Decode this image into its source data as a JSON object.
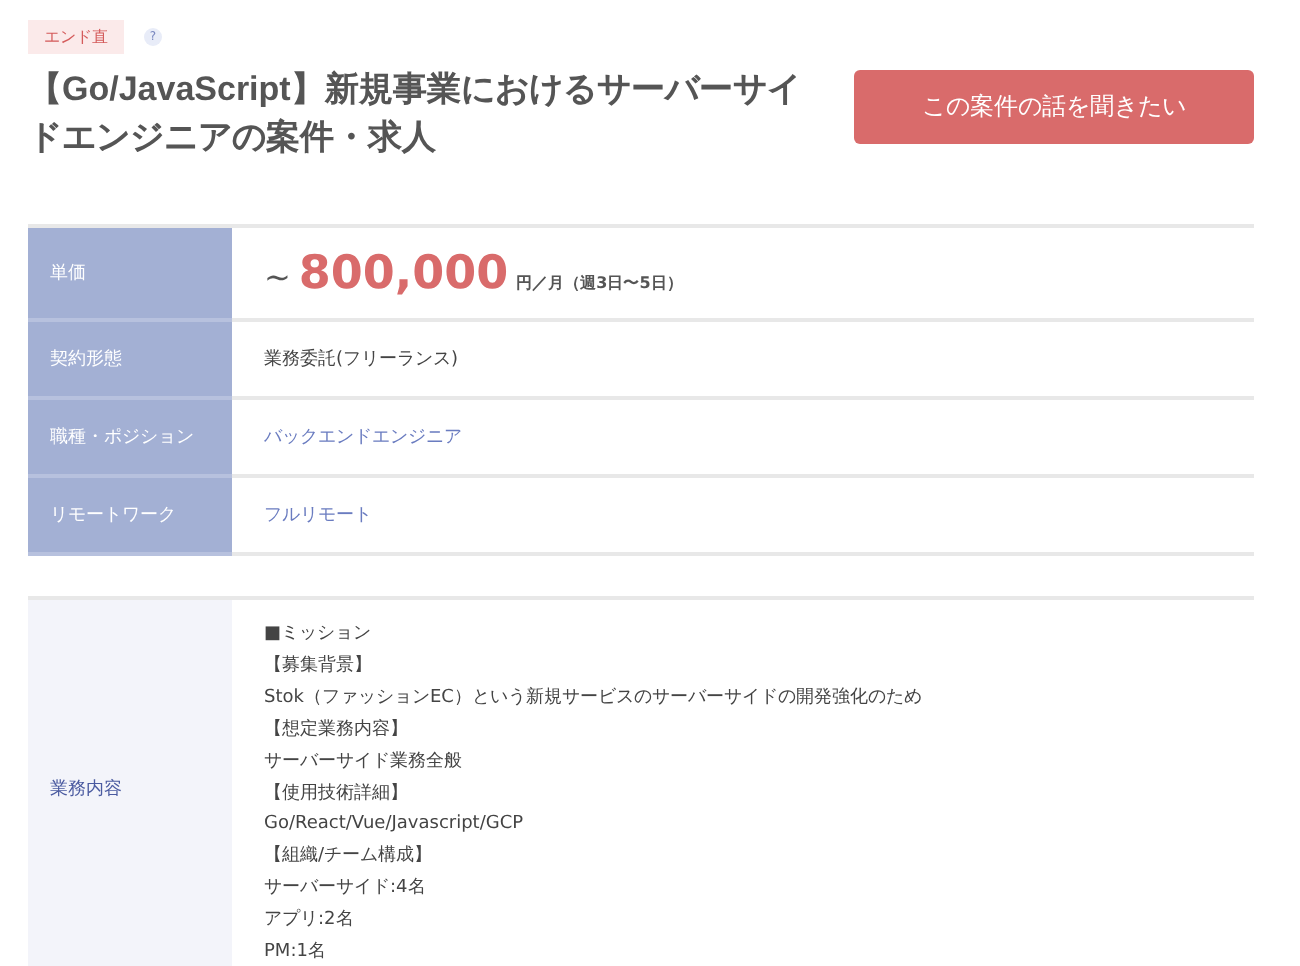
{
  "tag": {
    "label": "エンド直",
    "help": "?"
  },
  "title": "【Go/JavaScript】新規事業におけるサーバーサイドエンジニアの案件・求人",
  "cta_button": "この案件の話を聞きたい",
  "tables": [
    {
      "kind": "dark",
      "rows": [
        {
          "label": "単価",
          "kind": "price",
          "prefix": "~",
          "amount": "800,000",
          "unit": "円／月（週3日〜5日）"
        },
        {
          "label": "契約形態",
          "kind": "text",
          "value": "業務委託(フリーランス)"
        },
        {
          "label": "職種・ポジション",
          "kind": "link",
          "value": "バックエンドエンジニア"
        },
        {
          "label": "リモートワーク",
          "kind": "link",
          "value": "フルリモート"
        }
      ]
    },
    {
      "kind": "light",
      "rows": [
        {
          "label": "業務内容",
          "kind": "lines",
          "lines": [
            "■ミッション",
            "【募集背景】",
            "Stok（ファッションEC）という新規サービスのサーバーサイドの開発強化のため",
            "【想定業務内容】",
            "サーバーサイド業務全般",
            "【使用技術詳細】",
            "Go/React/Vue/Javascript/GCP",
            "【組織/チーム構成】",
            "サーバーサイド:4名",
            "アプリ:2名",
            "PM:1名"
          ]
        }
      ]
    }
  ]
}
